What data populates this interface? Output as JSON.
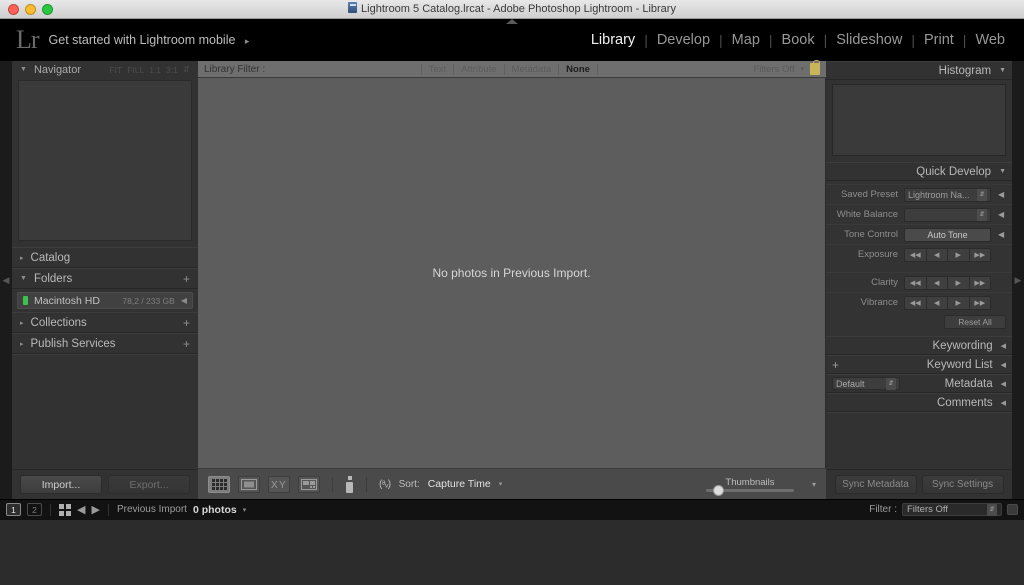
{
  "window": {
    "title": "Lightroom 5 Catalog.lrcat - Adobe Photoshop Lightroom - Library",
    "icon": "catalog-icon"
  },
  "identity": {
    "logo": "Lr",
    "tagline": "Get started with Lightroom mobile",
    "tagline_arrow": "▸"
  },
  "modules": {
    "items": [
      {
        "label": "Library",
        "active": true
      },
      {
        "label": "Develop",
        "active": false
      },
      {
        "label": "Map",
        "active": false
      },
      {
        "label": "Book",
        "active": false
      },
      {
        "label": "Slideshow",
        "active": false
      },
      {
        "label": "Print",
        "active": false
      },
      {
        "label": "Web",
        "active": false
      }
    ],
    "separator": "|"
  },
  "left_panel": {
    "navigator": {
      "title": "Navigator",
      "collapse_triangle": "▼",
      "zoom_levels": [
        "FIT",
        "FILL",
        "1:1",
        "3:1"
      ],
      "stepper_icon": "updown-stepper-icon"
    },
    "sections": [
      {
        "label": "Catalog",
        "triangle": "▸",
        "has_plus": false
      },
      {
        "label": "Folders",
        "triangle": "▼",
        "has_plus": true,
        "plus": "+"
      },
      {
        "label": "Collections",
        "triangle": "▸",
        "has_plus": true,
        "plus": "+"
      },
      {
        "label": "Publish Services",
        "triangle": "▸",
        "has_plus": true,
        "plus": "+"
      }
    ],
    "folder_volume": {
      "name": "Macintosh HD",
      "capacity": "78,2 / 233 GB",
      "status_color": "#3ec14a",
      "chevron": "◀"
    },
    "buttons": {
      "import": "Import...",
      "export": "Export..."
    }
  },
  "library_filter": {
    "label": "Library Filter :",
    "tabs": [
      "Text",
      "Attribute",
      "Metadata",
      "None"
    ],
    "active_tab": "None",
    "filters_state": "Filters Off",
    "caret": "▾",
    "lock_icon": "lock-icon"
  },
  "main": {
    "empty_message": "No photos in Previous Import."
  },
  "toolbar": {
    "view_modes": [
      {
        "name": "grid-view",
        "active": true
      },
      {
        "name": "loupe-view",
        "active": false
      },
      {
        "name": "compare-view",
        "active": false
      },
      {
        "name": "survey-view",
        "active": false
      }
    ],
    "painter_icon": "spray-can-icon",
    "sort_icon": "a-z-sort-icon",
    "sort_label": "Sort:",
    "sort_value": "Capture Time",
    "sort_caret": "▾",
    "thumbnails_label": "Thumbnails",
    "thumbnail_size_pct": 8,
    "toolbar_caret": "▾"
  },
  "right_panel": {
    "histogram": {
      "title": "Histogram",
      "triangle": "▼"
    },
    "quick_develop": {
      "title": "Quick Develop",
      "triangle": "▼",
      "rows": [
        {
          "label": "Saved Preset",
          "type": "dropdown",
          "value": "Lightroom Na...",
          "chevron": "◀"
        },
        {
          "label": "White Balance",
          "type": "dropdown",
          "value": "",
          "chevron": "◀"
        },
        {
          "label": "Tone Control",
          "type": "button",
          "value": "Auto Tone",
          "chevron": "◀"
        },
        {
          "label": "Exposure",
          "type": "stepper",
          "value": "",
          "chevron": ""
        },
        {
          "label": "Clarity",
          "type": "stepper",
          "value": "",
          "chevron": ""
        },
        {
          "label": "Vibrance",
          "type": "stepper",
          "value": "",
          "chevron": ""
        }
      ],
      "stepper_glyphs": [
        "◀◀",
        "◀",
        "▶",
        "▶▶"
      ],
      "reset_label": "Reset All"
    },
    "panels": [
      {
        "title": "Keywording",
        "chevron": "◀",
        "plus": "",
        "dropdown": ""
      },
      {
        "title": "Keyword List",
        "chevron": "◀",
        "plus": "+",
        "dropdown": ""
      },
      {
        "title": "Metadata",
        "chevron": "◀",
        "plus": "",
        "dropdown": "Default"
      },
      {
        "title": "Comments",
        "chevron": "◀",
        "plus": "",
        "dropdown": ""
      }
    ],
    "sync_buttons": {
      "metadata": "Sync Metadata",
      "settings": "Sync Settings"
    }
  },
  "filmstrip": {
    "screens": [
      {
        "label": "1",
        "active": true
      },
      {
        "label": "2",
        "active": false
      }
    ],
    "grid_icon": "grid-layout-icon",
    "back_arrow": "◀",
    "forward_arrow": "▶",
    "source_label": "Previous Import",
    "photo_count": "0 photos",
    "count_caret": "▾",
    "filter_label": "Filter :",
    "filter_value": "Filters Off",
    "filter_caret": "▾"
  },
  "colors": {
    "panel_bg": "#323232",
    "work_area": "#5d5d5d",
    "filter_bar": "#6e6e6e",
    "toolbar_bg": "#4a4a4a",
    "chrome_black": "#000000",
    "accent_green": "#3ec14a",
    "lock_yellow": "#c8b45a"
  }
}
